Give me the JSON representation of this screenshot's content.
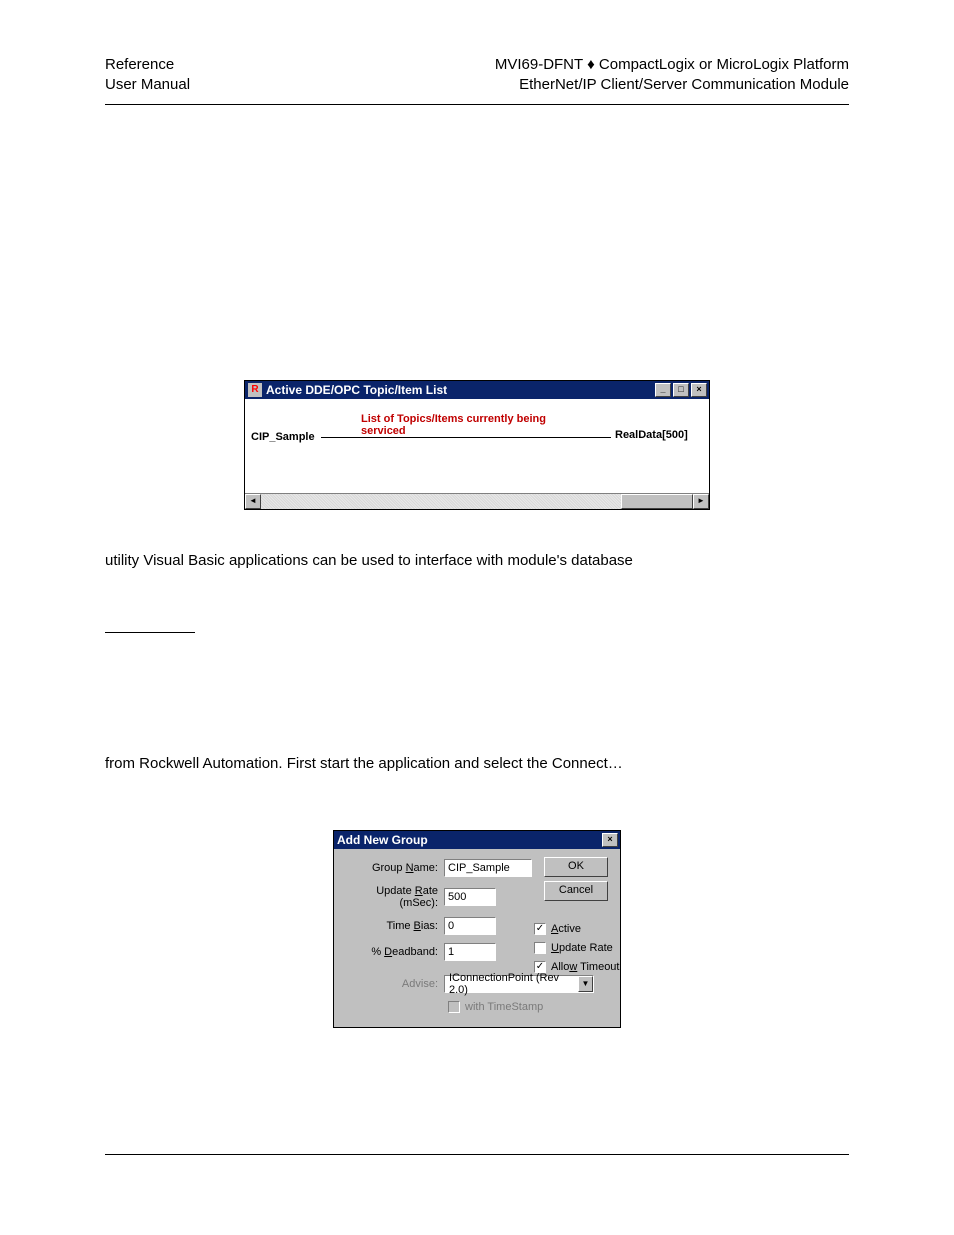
{
  "header": {
    "left_line1": "Reference",
    "left_line2": "User Manual",
    "right_line1": "MVI69-DFNT ♦ CompactLogix or MicroLogix Platform",
    "right_line2": "EtherNet/IP Client/Server Communication Module"
  },
  "window1": {
    "title": "Active DDE/OPC Topic/Item List",
    "min": "_",
    "max": "□",
    "close": "×",
    "heading": "List of Topics/Items currently being serviced",
    "left_item": "CIP_Sample",
    "right_item": "RealData[500]",
    "scroll_left": "◄",
    "scroll_right": "►"
  },
  "paragraph1": "utility Visual Basic applications can be used to interface with module's database",
  "paragraph2": "from Rockwell Automation. First start the application and select the Connect…",
  "window2": {
    "title": "Add New Group",
    "close": "×",
    "ok": "OK",
    "cancel": "Cancel",
    "labels": {
      "group_name_pre": "Group ",
      "group_name_u": "N",
      "group_name_post": "ame:",
      "update_rate_pre": "Update ",
      "update_rate_u": "R",
      "update_rate_post": "ate (mSec):",
      "time_bias_pre": "Time ",
      "time_bias_u": "B",
      "time_bias_post": "ias:",
      "deadband_pre": "% ",
      "deadband_u": "D",
      "deadband_post": "eadband:",
      "advise": "Advise:"
    },
    "values": {
      "group_name": "CIP_Sample",
      "update_rate": "500",
      "time_bias": "0",
      "deadband": "1",
      "advise_select": "IConnectionPoint (Rev 2.0)"
    },
    "checks": {
      "active_u": "A",
      "active_post": "ctive",
      "active_checked": "✓",
      "update_rate_u": "U",
      "update_rate_post": "pdate Rate",
      "update_rate_checked": "",
      "allow_pre": "Allo",
      "allow_u": "w",
      "allow_post": " Timeout",
      "allow_checked": "✓"
    },
    "timestamp_label": "with TimeStamp",
    "dropdown_arrow": "▼"
  }
}
